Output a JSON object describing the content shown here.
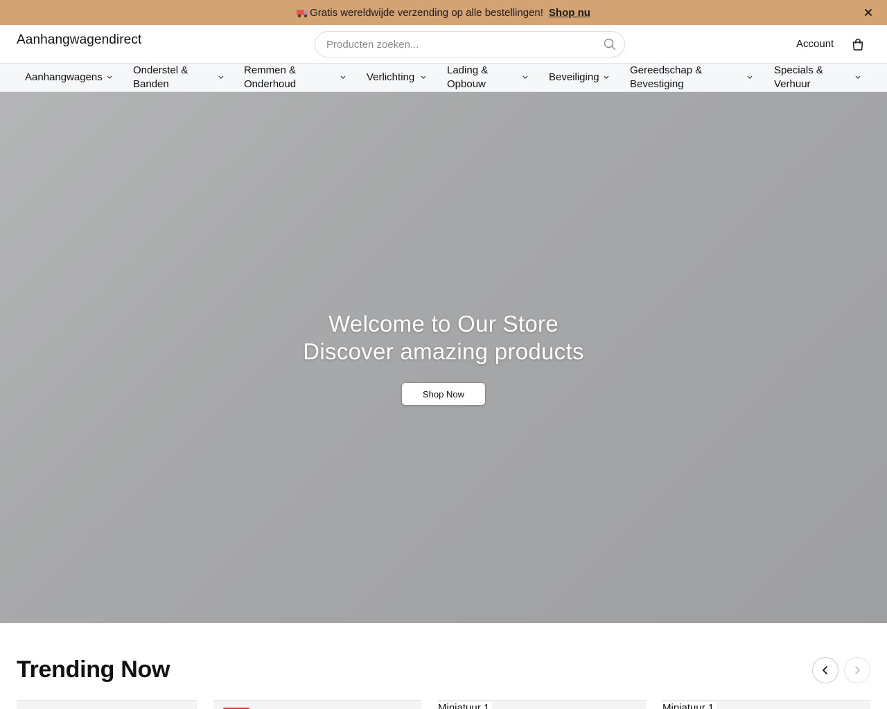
{
  "announcement": {
    "text": "Gratis wereldwijde verzending op alle bestellingen!",
    "link": "Shop nu",
    "icon": "truck-icon",
    "close_icon": "close-icon",
    "bg_color": "#d4a373"
  },
  "header": {
    "logo": "Aanhangwagendirect",
    "search_placeholder": "Producten zoeken...",
    "account": "Account",
    "cart_icon": "shopping-bag-icon"
  },
  "nav": {
    "items": [
      {
        "line1": "Aanhangwagens",
        "line2": ""
      },
      {
        "line1": "Onderstel &",
        "line2": "Banden"
      },
      {
        "line1": "Remmen &",
        "line2": "Onderhoud"
      },
      {
        "line1": "Verlichting",
        "line2": ""
      },
      {
        "line1": "Lading &",
        "line2": "Opbouw"
      },
      {
        "line1": "Beveiliging",
        "line2": ""
      },
      {
        "line1": "Gereedschap &",
        "line2": "Bevestiging"
      },
      {
        "line1": "Specials &",
        "line2": "Verhuur"
      }
    ]
  },
  "hero": {
    "title_line1": "Welcome to Our Store",
    "title_line2": "Discover amazing products",
    "cta": "Shop Now"
  },
  "trending": {
    "title": "Trending Now",
    "products": [
      {
        "name": ""
      },
      {
        "name": ""
      },
      {
        "name": "Miniatuur 1"
      },
      {
        "name": "Miniatuur 1"
      }
    ]
  }
}
